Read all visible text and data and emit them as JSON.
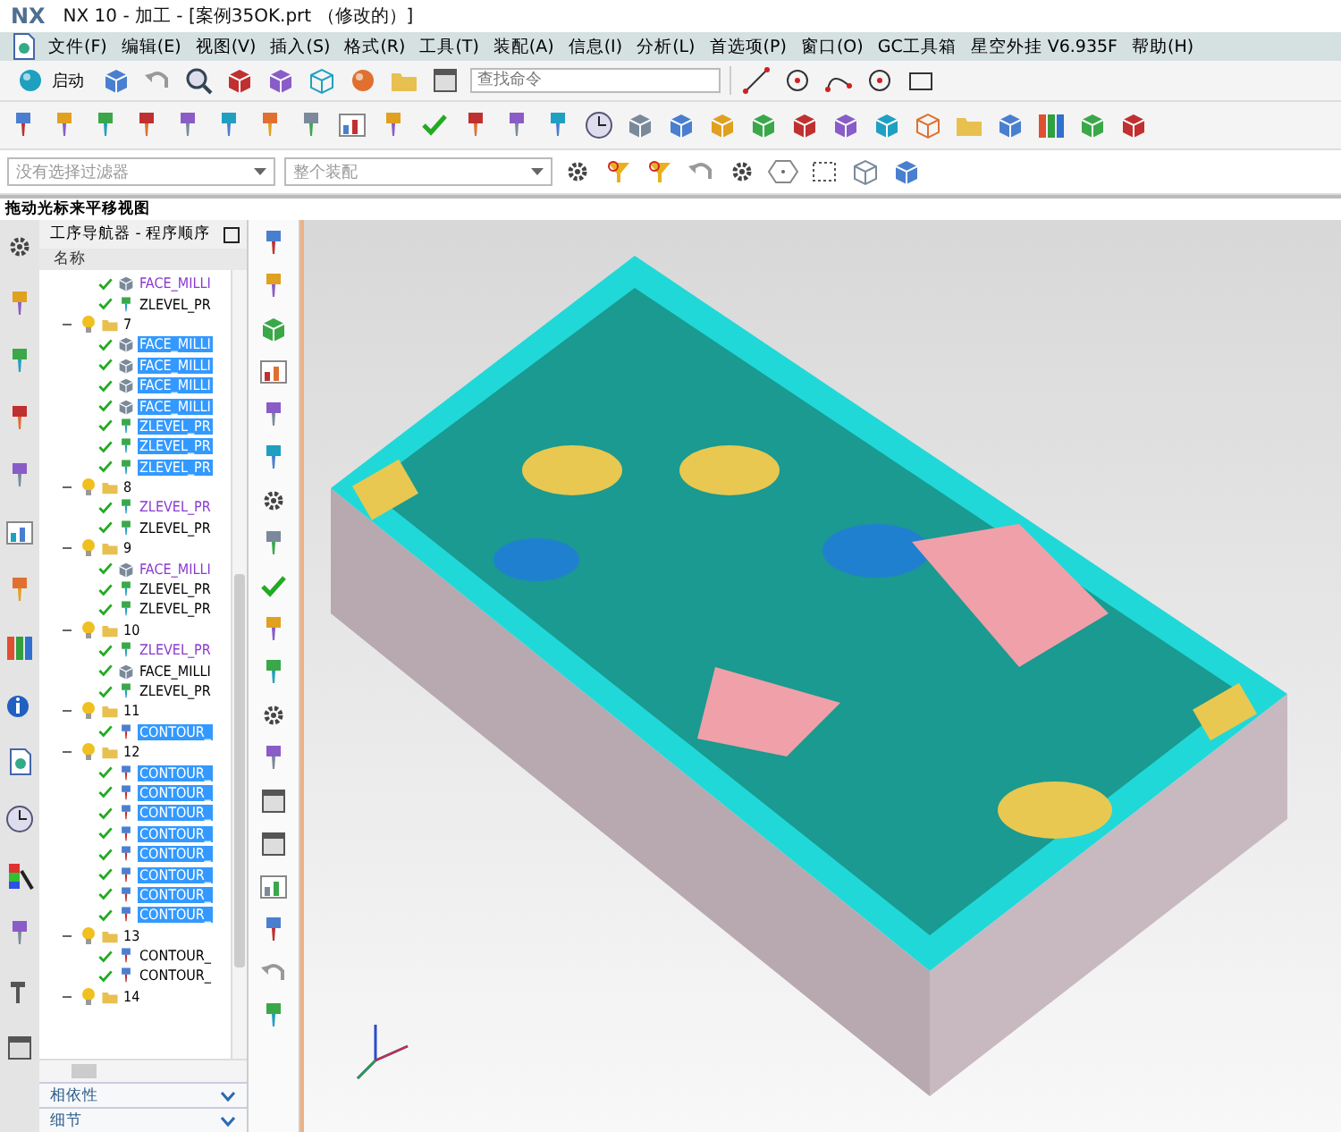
{
  "window": {
    "logo": "NX",
    "title": "NX 10 - 加工 - [案例35OK.prt （修改的）]"
  },
  "menu": [
    "文件(F)",
    "编辑(E)",
    "视图(V)",
    "插入(S)",
    "格式(R)",
    "工具(T)",
    "装配(A)",
    "信息(I)",
    "分析(L)",
    "首选项(P)",
    "窗口(O)",
    "GC工具箱",
    "星空外挂 V6.935F",
    "帮助(H)"
  ],
  "toolbar": {
    "start_button": "启动",
    "command_search": {
      "placeholder": "查找命令"
    },
    "selection_filter": "没有选择过滤器",
    "scope_filter": "整个装配"
  },
  "hint": "拖动光标来平移视图",
  "navigator": {
    "title": "工序导航器 - 程序顺序",
    "column": "名称",
    "tree": [
      {
        "kind": "face",
        "label": "FACE_MILLI",
        "modified": true,
        "selected": false
      },
      {
        "kind": "zlevel",
        "label": "ZLEVEL_PR",
        "modified": false,
        "selected": false
      },
      {
        "kind": "group",
        "label": "7",
        "expanded": true,
        "children": [
          {
            "kind": "face",
            "label": "FACE_MILLI",
            "modified": false,
            "selected": true
          },
          {
            "kind": "face",
            "label": "FACE_MILLI",
            "modified": false,
            "selected": true
          },
          {
            "kind": "face",
            "label": "FACE_MILLI",
            "modified": false,
            "selected": true
          },
          {
            "kind": "face",
            "label": "FACE_MILLI",
            "modified": false,
            "selected": true
          },
          {
            "kind": "zlevel",
            "label": "ZLEVEL_PR",
            "modified": false,
            "selected": true
          },
          {
            "kind": "zlevel",
            "label": "ZLEVEL_PR",
            "modified": false,
            "selected": true
          },
          {
            "kind": "zlevel",
            "label": "ZLEVEL_PR",
            "modified": false,
            "selected": true
          }
        ]
      },
      {
        "kind": "group",
        "label": "8",
        "expanded": true,
        "children": [
          {
            "kind": "zlevel",
            "label": "ZLEVEL_PR",
            "modified": true,
            "selected": false
          },
          {
            "kind": "zlevel",
            "label": "ZLEVEL_PR",
            "modified": false,
            "selected": false
          }
        ]
      },
      {
        "kind": "group",
        "label": "9",
        "expanded": true,
        "children": [
          {
            "kind": "face",
            "label": "FACE_MILLI",
            "modified": true,
            "selected": false
          },
          {
            "kind": "zlevel",
            "label": "ZLEVEL_PR",
            "modified": false,
            "selected": false
          },
          {
            "kind": "zlevel",
            "label": "ZLEVEL_PR",
            "modified": false,
            "selected": false
          }
        ]
      },
      {
        "kind": "group",
        "label": "10",
        "expanded": true,
        "children": [
          {
            "kind": "zlevel",
            "label": "ZLEVEL_PR",
            "modified": true,
            "selected": false
          },
          {
            "kind": "face",
            "label": "FACE_MILLI",
            "modified": false,
            "selected": false
          },
          {
            "kind": "zlevel",
            "label": "ZLEVEL_PR",
            "modified": false,
            "selected": false
          }
        ]
      },
      {
        "kind": "group",
        "label": "11",
        "expanded": true,
        "children": [
          {
            "kind": "contour",
            "label": "CONTOUR_",
            "modified": false,
            "selected": true
          }
        ]
      },
      {
        "kind": "group",
        "label": "12",
        "expanded": true,
        "children": [
          {
            "kind": "contour",
            "label": "CONTOUR_",
            "modified": false,
            "selected": true
          },
          {
            "kind": "contour",
            "label": "CONTOUR_",
            "modified": false,
            "selected": true
          },
          {
            "kind": "contour",
            "label": "CONTOUR_",
            "modified": false,
            "selected": true
          },
          {
            "kind": "contour",
            "label": "CONTOUR_",
            "modified": false,
            "selected": true
          },
          {
            "kind": "contour",
            "label": "CONTOUR_",
            "modified": false,
            "selected": true
          },
          {
            "kind": "contour",
            "label": "CONTOUR_",
            "modified": false,
            "selected": true
          },
          {
            "kind": "contour",
            "label": "CONTOUR_",
            "modified": false,
            "selected": true
          },
          {
            "kind": "contour",
            "label": "CONTOUR_",
            "modified": false,
            "selected": true
          }
        ]
      },
      {
        "kind": "group",
        "label": "13",
        "expanded": true,
        "children": [
          {
            "kind": "contour",
            "label": "CONTOUR_",
            "modified": false,
            "selected": false
          },
          {
            "kind": "contour",
            "label": "CONTOUR_",
            "modified": false,
            "selected": false
          }
        ]
      },
      {
        "kind": "group",
        "label": "14",
        "expanded": true
      }
    ],
    "panels": [
      {
        "label": "相依性",
        "expanded": false
      },
      {
        "label": "细节",
        "expanded": false
      }
    ]
  }
}
